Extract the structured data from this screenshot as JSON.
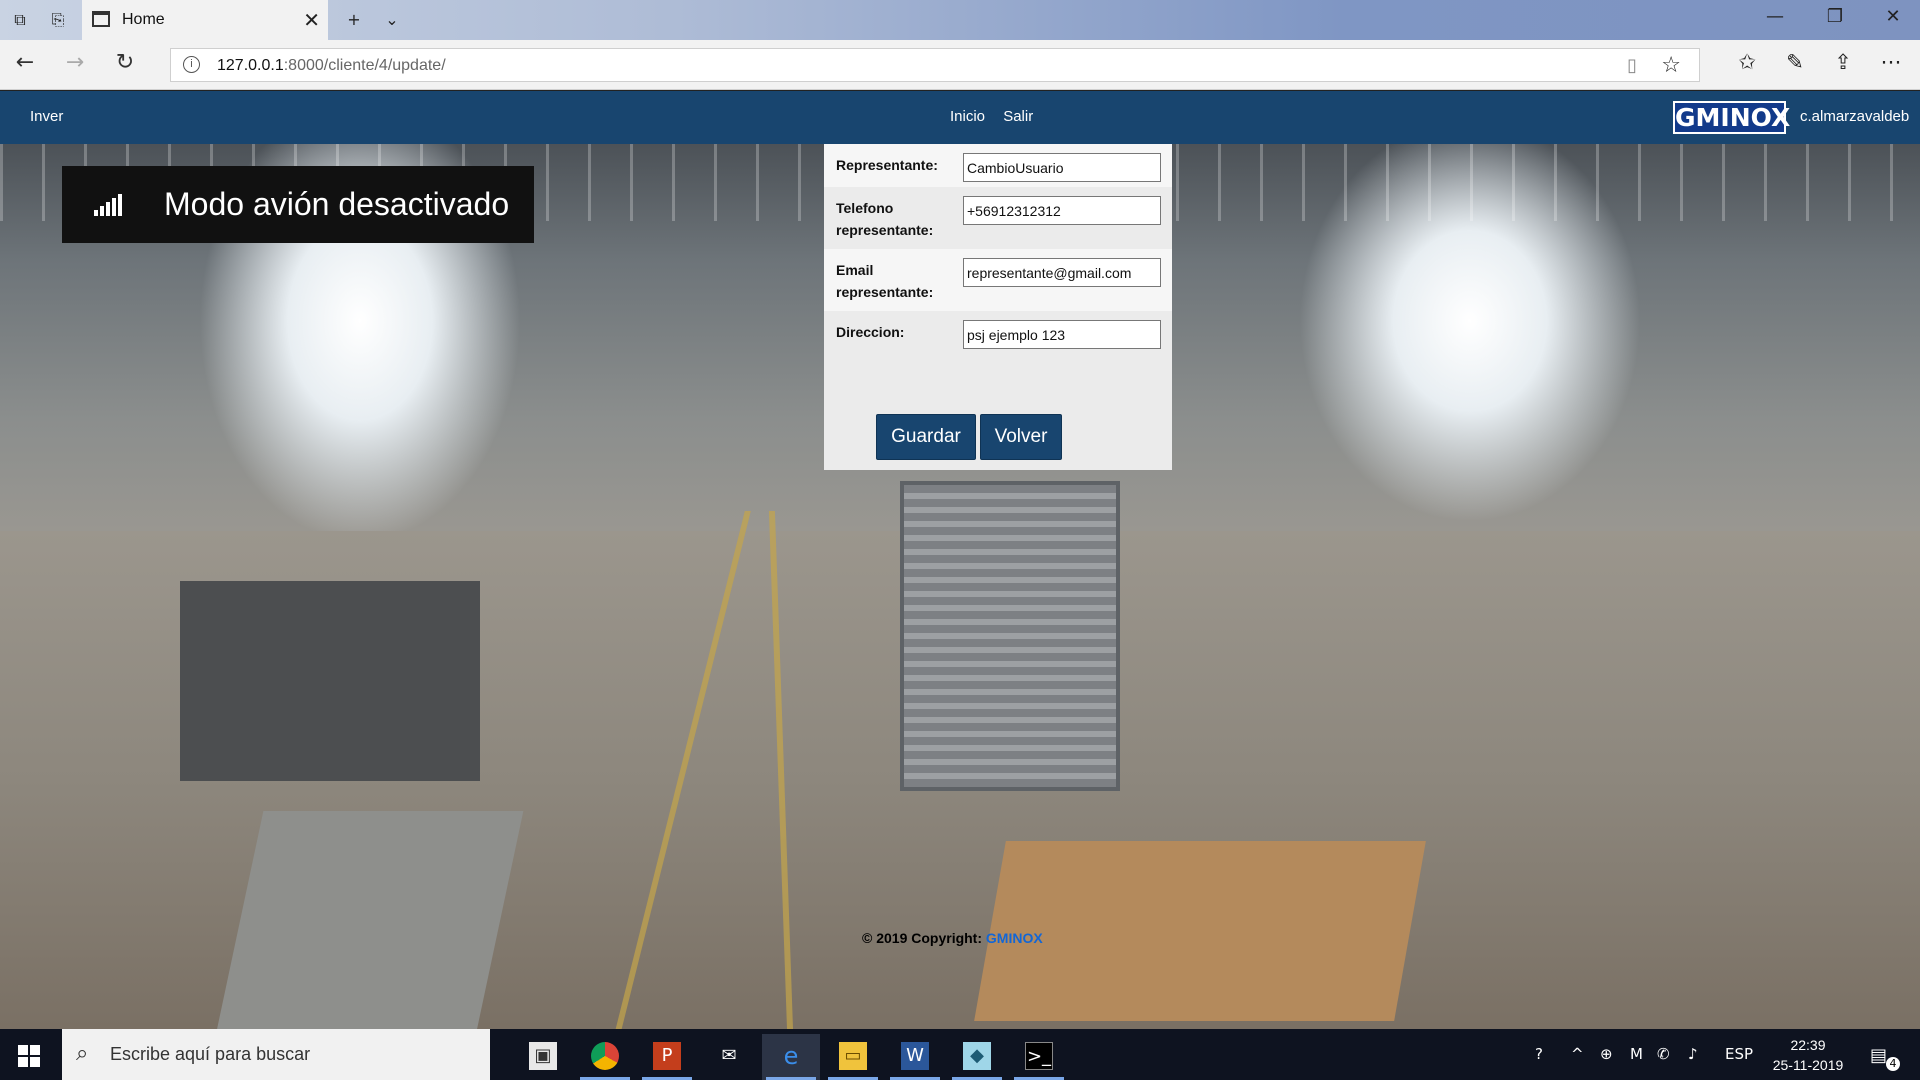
{
  "browser": {
    "tab_title": "Home",
    "url_host": "127.0.0.1",
    "url_rest": ":8000/cliente/4/update/"
  },
  "navbar": {
    "brand_left": "Inver",
    "links": [
      "Inicio",
      "Salir"
    ],
    "logo": "GMINOX",
    "user": "c.almarzavaldeb"
  },
  "toast": {
    "message": "Modo avión desactivado"
  },
  "form": {
    "fields": [
      {
        "label": "Representante:",
        "value": "CambioUsuario"
      },
      {
        "label": "Telefono representante:",
        "value": "+56912312312"
      },
      {
        "label": "Email representante:",
        "value": "representante@gmail.com"
      },
      {
        "label": "Direccion:",
        "value": "psj ejemplo 123"
      }
    ],
    "save_label": "Guardar",
    "back_label": "Volver"
  },
  "footer": {
    "copyright_text": "© 2019 Copyright: ",
    "copyright_brand": "GMINOX"
  },
  "taskbar": {
    "search_placeholder": "Escribe aquí para buscar",
    "language": "ESP",
    "time": "22:39",
    "date": "25-11-2019",
    "notification_count": "4"
  }
}
